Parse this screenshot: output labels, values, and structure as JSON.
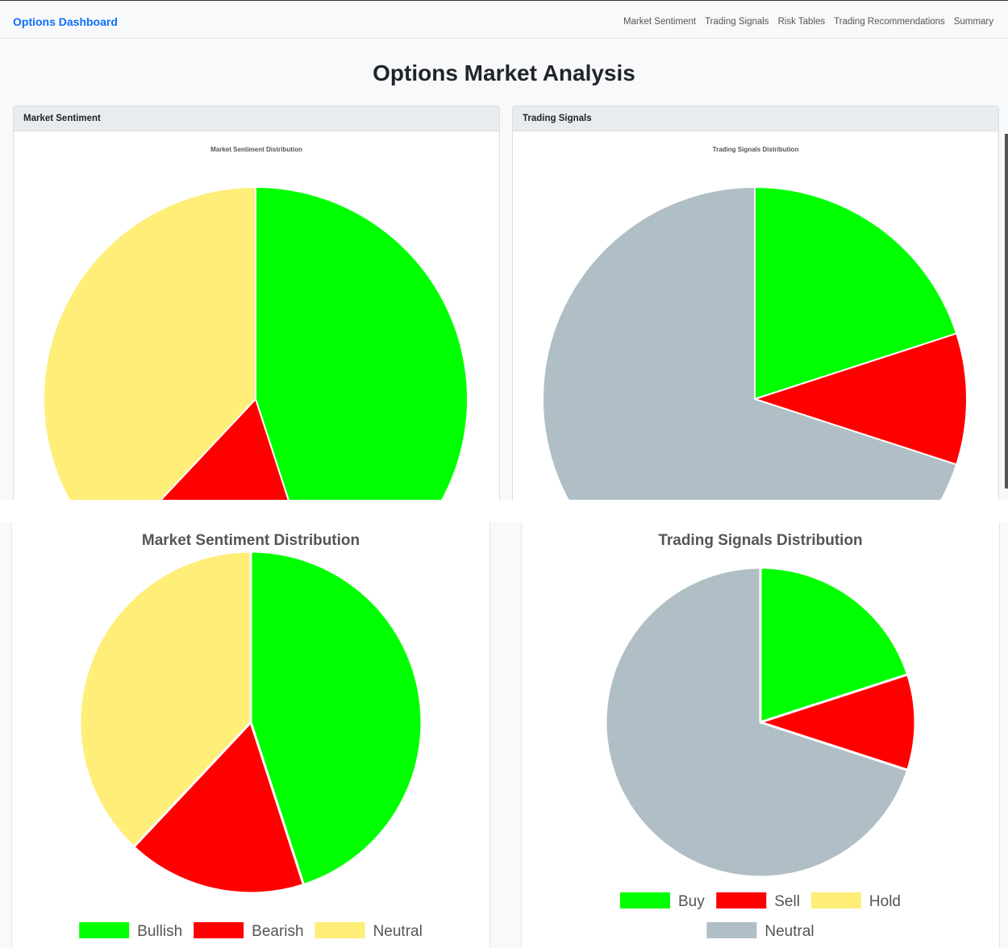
{
  "navbar": {
    "brand": "Options Dashboard",
    "links": [
      "Market Sentiment",
      "Trading Signals",
      "Risk Tables",
      "Trading Recommendations",
      "Summary"
    ]
  },
  "page": {
    "title": "Options Market Analysis"
  },
  "cards": {
    "sentiment_header": "Market Sentiment",
    "signals_header": "Trading Signals"
  },
  "chart_data": [
    {
      "type": "pie",
      "title": "Market Sentiment Distribution",
      "categories": [
        "Bullish",
        "Bearish",
        "Neutral"
      ],
      "values": [
        45,
        17,
        38
      ],
      "colors": [
        "#00ff00",
        "#ff0000",
        "#ffee77"
      ],
      "legend": "bottom"
    },
    {
      "type": "pie",
      "title": "Trading Signals Distribution",
      "categories": [
        "Buy",
        "Sell",
        "Hold",
        "Neutral"
      ],
      "values": [
        20,
        10,
        0,
        70
      ],
      "colors": [
        "#00ff00",
        "#ff0000",
        "#ffee77",
        "#b0bec5"
      ],
      "legend": "bottom"
    }
  ]
}
